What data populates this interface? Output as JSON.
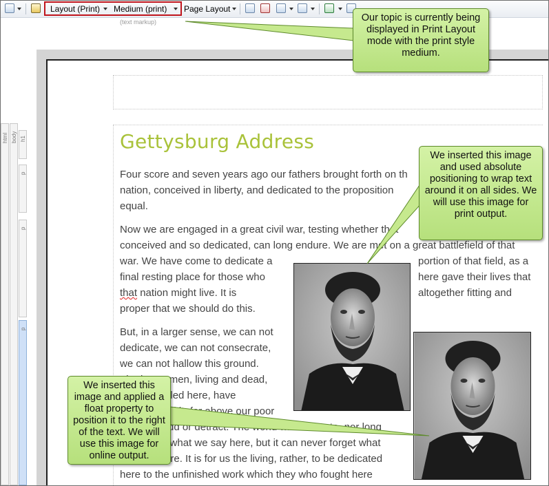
{
  "toolbar": {
    "layout_label": "Layout (Print)",
    "medium_label": "Medium (print)",
    "page_layout_label": "Page Layout",
    "text_markup": "(text markup)"
  },
  "structure_bar": {
    "html": "html",
    "body": "body",
    "h1": "h1",
    "p1": "p",
    "p2": "p",
    "p3": "p"
  },
  "document": {
    "title": "Gettysburg Address",
    "lines": [
      "Four score and seven years ago our fathers brought forth on th",
      "nation, conceived in liberty, and dedicated to the proposition",
      "equal.",
      "Now we are engaged in a great civil war, testing whether that",
      "conceived and so dedicated, can long endure. We are met on a great battlefield of that",
      "war. We have come to dedicate a",
      "portion of that field, as a",
      "final resting place for those who",
      "here gave their lives that",
      "that",
      " nation might live. It is",
      "altogether fitting and",
      "proper that we should do this.",
      "But, in a larger sense, we can not",
      "dedicate, we can not consecrate,",
      "we can not hallow this ground.",
      "The brave men, living and dead,",
      "who struggled here, have",
      "consecrated it, far above our poor",
      "power to add or detract. The world will little note, nor long",
      "remember what we say here, but it can never forget what",
      "they did here. It is for us the living, rather, to be dedicated",
      "here to the unfinished work which they who fought here"
    ]
  },
  "callouts": {
    "top": "Our topic is currently being displayed in Print Layout mode with the print style medium.",
    "right": "We inserted this image and used absolute positioning to wrap text around it on all sides. We will use this image for print output.",
    "bottom": "We inserted this image and applied a float property to position it to the right of the text. We will use this image for online output."
  },
  "colors": {
    "title": "#a9c23a",
    "callout_fill": "#c6e98e",
    "callout_border": "#5d8a2a",
    "highlight_box": "#c0141c"
  },
  "icons": [
    "view-mode-icon",
    "format-brush-icon",
    "insert-image-icon",
    "link-icon",
    "table-icon",
    "variable-icon",
    "spell-check-icon"
  ]
}
